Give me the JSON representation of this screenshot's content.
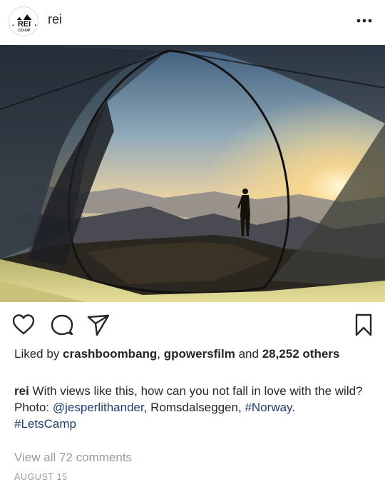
{
  "post": {
    "username": "rei",
    "avatar_text": "REI",
    "avatar_subtext": "CO-OP"
  },
  "actions": {
    "like_icon": "heart-icon",
    "comment_icon": "comment-icon",
    "share_icon": "send-icon",
    "save_icon": "bookmark-icon"
  },
  "likes": {
    "prefix": "Liked by ",
    "user1": "crashboombang",
    "sep": ", ",
    "user2": "gpowersfilm",
    "and": " and ",
    "count_text": "28,252 others"
  },
  "caption": {
    "user": "rei",
    "line1": " With views like this, how can you not fall in love with the wild?",
    "photo_label": "Photo: ",
    "mention": "@jesperlithander",
    "location": ", Romsdalseggen, ",
    "hashtag1": "#Norway",
    "period": ".",
    "hashtag2": "#LetsCamp"
  },
  "comments": {
    "view_all": "View all 72 comments"
  },
  "date": "AUGUST 15",
  "colors": {
    "link": "#1f3e6b",
    "muted": "#9a9a9a",
    "text": "#262626"
  }
}
